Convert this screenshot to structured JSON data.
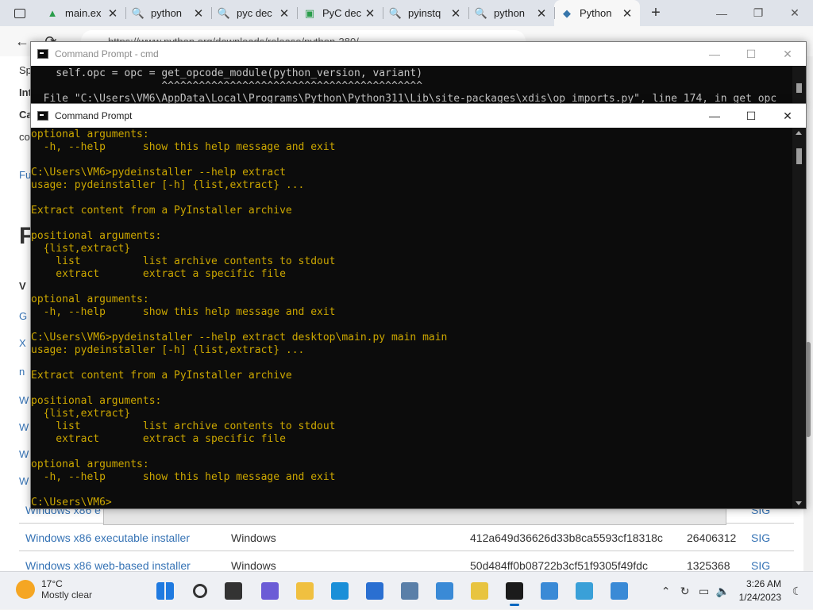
{
  "browser": {
    "tabs": [
      {
        "label": "main.ex",
        "icon": "google-drive-icon"
      },
      {
        "label": "python",
        "icon": "search-icon"
      },
      {
        "label": "pyc dec",
        "icon": "search-icon"
      },
      {
        "label": "PyC dec",
        "icon": "page-icon"
      },
      {
        "label": "pyinstq",
        "icon": "search-icon"
      },
      {
        "label": "python",
        "icon": "search-icon"
      },
      {
        "label": "Python",
        "icon": "python-icon"
      }
    ],
    "url": "https://www.python.org/downloads/release/python-380/"
  },
  "webpage": {
    "fragments": [
      "Sp",
      "Int",
      "Ca",
      "co",
      "Fu",
      "F",
      "V",
      "G",
      "X",
      "n",
      "W",
      "W",
      "W",
      "W"
    ],
    "table": [
      {
        "name": "Windows x86 e",
        "os": "",
        "md5": "",
        "size": "",
        "sig": "SIG"
      },
      {
        "name": "Windows x86 executable installer",
        "os": "Windows",
        "md5": "412a649d36626d33b8ca5593cf18318c",
        "size": "26406312",
        "sig": "SIG"
      },
      {
        "name": "Windows x86 web-based installer",
        "os": "Windows",
        "md5": "50d484ff0b08722b3cf51f9305f49fdc",
        "size": "1325368",
        "sig": "SIG"
      }
    ]
  },
  "cmd_back": {
    "title": "Command Prompt - cmd",
    "lines": [
      "    self.opc = opc = get_opcode_module(python_version, variant)",
      "                     ^^^^^^^^^^^^^^^^^^^^^^^^^^^^^^^^^^^^^^^^^^",
      "  File \"C:\\Users\\VM6\\AppData\\Local\\Programs\\Python\\Python311\\Lib\\site-packages\\xdis\\op_imports.py\", line 174, in get_opc"
    ]
  },
  "cmd_front": {
    "title": "Command Prompt",
    "lines": [
      "optional arguments:",
      "  -h, --help      show this help message and exit",
      "",
      "C:\\Users\\VM6>pydeinstaller --help extract",
      "usage: pydeinstaller [-h] {list,extract} ...",
      "",
      "Extract content from a PyInstaller archive",
      "",
      "positional arguments:",
      "  {list,extract}",
      "    list          list archive contents to stdout",
      "    extract       extract a specific file",
      "",
      "optional arguments:",
      "  -h, --help      show this help message and exit",
      "",
      "C:\\Users\\VM6>pydeinstaller --help extract desktop\\main.py main main",
      "usage: pydeinstaller [-h] {list,extract} ...",
      "",
      "Extract content from a PyInstaller archive",
      "",
      "positional arguments:",
      "  {list,extract}",
      "    list          list archive contents to stdout",
      "    extract       extract a specific file",
      "",
      "optional arguments:",
      "  -h, --help      show this help message and exit",
      "",
      "C:\\Users\\VM6>"
    ]
  },
  "taskbar": {
    "weather_temp": "17°C",
    "weather_desc": "Mostly clear",
    "time": "3:26 AM",
    "date": "1/24/2023",
    "apps": [
      {
        "name": "start-button",
        "color": "#1f7ae0"
      },
      {
        "name": "search-button",
        "color": "#333333"
      },
      {
        "name": "task-view-button",
        "color": "#333333"
      },
      {
        "name": "chat-button",
        "color": "#6b5cd6"
      },
      {
        "name": "file-explorer-button",
        "color": "#f0c040"
      },
      {
        "name": "edge-button",
        "color": "#1a8fd8"
      },
      {
        "name": "store-button",
        "color": "#2a6fd1"
      },
      {
        "name": "settings-button",
        "color": "#5a7fa8"
      },
      {
        "name": "app-1-button",
        "color": "#3a8ad6"
      },
      {
        "name": "app-2-button",
        "color": "#e8c440"
      },
      {
        "name": "terminal-button",
        "color": "#1b1b1b"
      },
      {
        "name": "app-3-button",
        "color": "#3a8ad6"
      },
      {
        "name": "app-4-button",
        "color": "#3aa0d8"
      },
      {
        "name": "app-5-button",
        "color": "#3a8ad6"
      }
    ]
  }
}
